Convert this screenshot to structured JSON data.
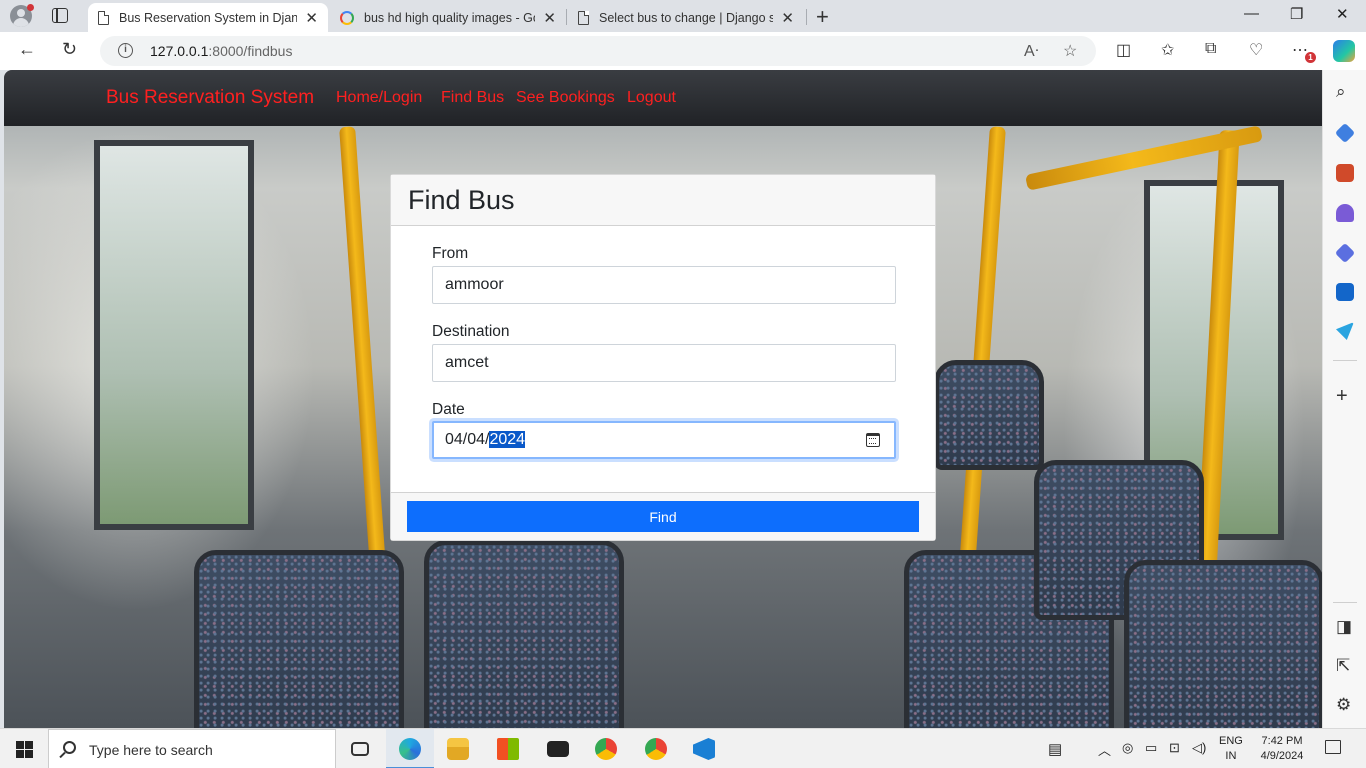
{
  "browser": {
    "tabs": [
      {
        "title": "Bus Reservation System in Djang",
        "icon": "page-icon",
        "active": true
      },
      {
        "title": "bus hd high quality images - Goo",
        "icon": "google-icon",
        "active": false
      },
      {
        "title": "Select bus to change | Django sit",
        "icon": "page-icon",
        "active": false
      }
    ],
    "close_glyph": "✕",
    "newtab_glyph": "+",
    "window_controls": {
      "minimize": "—",
      "restore": "❐",
      "close": "✕"
    },
    "url_host": "127.0.0.1",
    "url_path": ":8000/findbus",
    "extension_badge": "1"
  },
  "site": {
    "brand": "Bus Reservation System",
    "nav": [
      "Home/Login",
      "Find Bus",
      "See Bookings",
      "Logout"
    ]
  },
  "form": {
    "title": "Find Bus",
    "from_label": "From",
    "from_value": "ammoor",
    "destination_label": "Destination",
    "destination_value": "amcet",
    "date_label": "Date",
    "date_prefix": "04/04/",
    "date_selected": "2024",
    "submit_label": "Find"
  },
  "taskbar": {
    "search_placeholder": "Type here to search",
    "lang_line1": "ENG",
    "lang_line2": "IN",
    "time": "7:42 PM",
    "date": "4/9/2024"
  },
  "colors": {
    "brand_red": "#ff2020",
    "primary_button": "#0d6efd",
    "navbar_dark": "#202226"
  }
}
